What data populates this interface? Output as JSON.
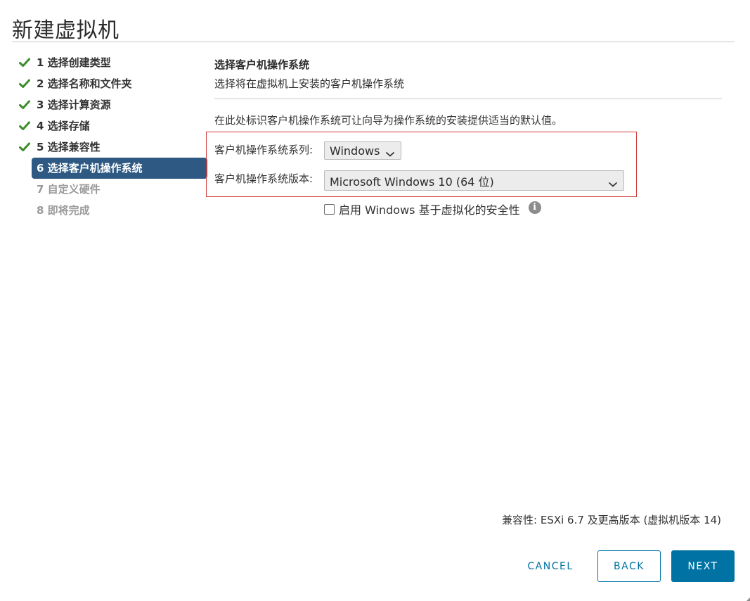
{
  "dialog": {
    "title": "新建虚拟机"
  },
  "steps": [
    {
      "label": "1 选择创建类型",
      "state": "done"
    },
    {
      "label": "2 选择名称和文件夹",
      "state": "done"
    },
    {
      "label": "3 选择计算资源",
      "state": "done"
    },
    {
      "label": "4 选择存储",
      "state": "done"
    },
    {
      "label": "5 选择兼容性",
      "state": "done"
    },
    {
      "label": "6 选择客户机操作系统",
      "state": "active"
    },
    {
      "label": "7 自定义硬件",
      "state": "pending"
    },
    {
      "label": "8 即将完成",
      "state": "pending"
    }
  ],
  "main": {
    "section_title": "选择客户机操作系统",
    "section_desc": "选择将在虚拟机上安装的客户机操作系统",
    "hint": "在此处标识客户机操作系统可让向导为操作系统的安装提供适当的默认值。",
    "os_family": {
      "label": "客户机操作系统系列:",
      "value": "Windows"
    },
    "os_version": {
      "label": "客户机操作系统版本:",
      "value": "Microsoft Windows 10 (64 位)"
    },
    "vbs_checkbox": {
      "label": "启用 Windows 基于虚拟化的安全性",
      "checked": false
    }
  },
  "footer": {
    "compatibility": "兼容性: ESXi 6.7 及更高版本 (虚拟机版本 14)",
    "cancel_label": "CANCEL",
    "back_label": "BACK",
    "next_label": "NEXT"
  },
  "colors": {
    "accent": "#0072a3",
    "active_step": "#2d5982",
    "check": "#3c8d2a",
    "highlight_border": "#d13a3a"
  },
  "icons": {
    "done_step": "check-icon",
    "dropdown": "chevron-down-icon",
    "info": "info-icon"
  }
}
